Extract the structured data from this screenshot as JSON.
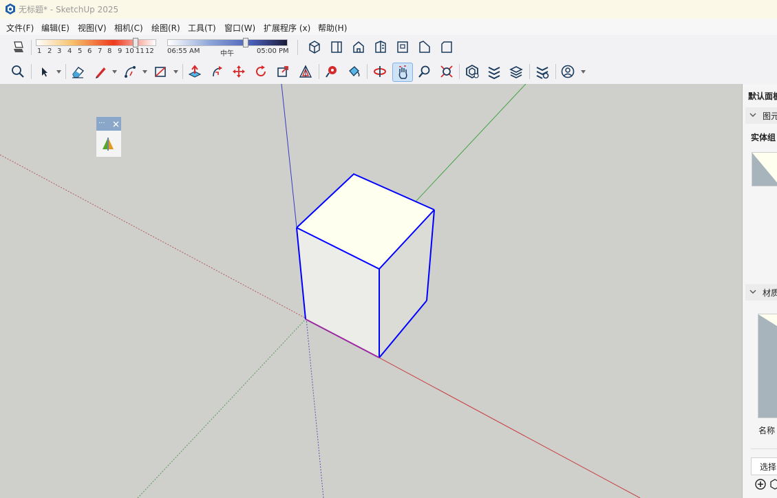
{
  "window": {
    "title": "无标题* - SketchUp 2025"
  },
  "menu": [
    "文件(F)",
    "编辑(E)",
    "视图(V)",
    "相机(C)",
    "绘图(R)",
    "工具(T)",
    "窗口(W)",
    "扩展程序 (x)",
    "帮助(H)"
  ],
  "shadow": {
    "months": [
      "1",
      "2",
      "3",
      "4",
      "5",
      "6",
      "7",
      "8",
      "9",
      "10",
      "11",
      "12"
    ],
    "month_level": 0.9,
    "time_start": "06:55 AM",
    "time_mid": "中午",
    "time_end": "05:00 PM",
    "time_level": 0.65
  },
  "tray": {
    "title": "默认面板",
    "entity_section": "图元",
    "entity_type": "实体组",
    "materials_section": "材质",
    "name_label": "名称",
    "select_tab": "选择"
  },
  "colors": {
    "accent_blue": "#0000ff",
    "face_top": "#fffff0",
    "ground": "#cfcfcb"
  }
}
